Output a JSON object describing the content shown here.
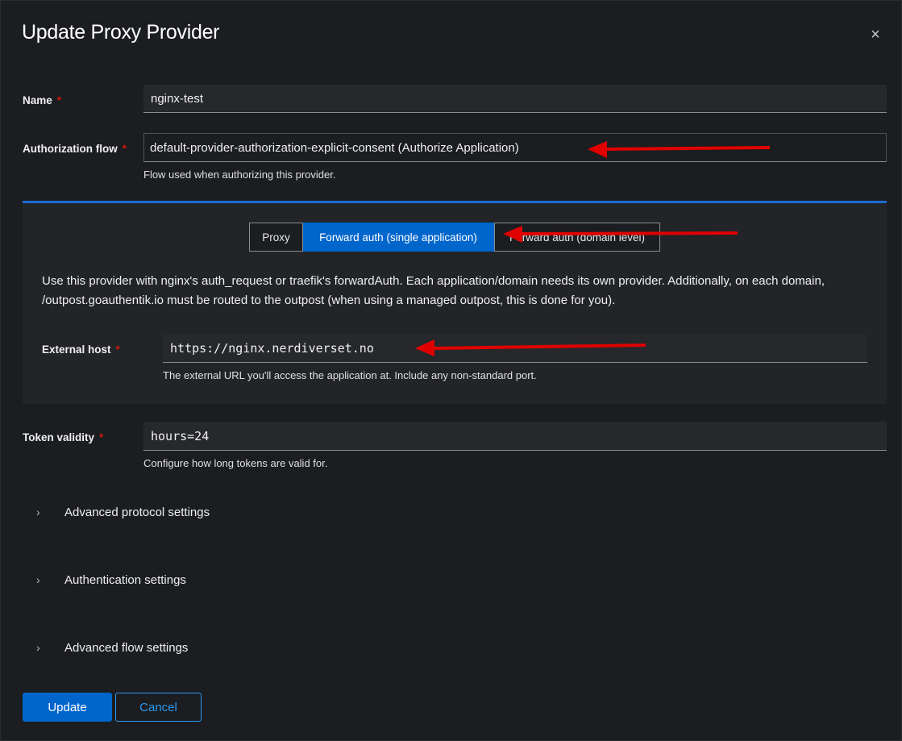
{
  "modal": {
    "title": "Update Proxy Provider",
    "close_glyph": "×"
  },
  "name": {
    "label": "Name",
    "required": "*",
    "value": "nginx-test"
  },
  "authorization_flow": {
    "label": "Authorization flow",
    "required": "*",
    "value": "default-provider-authorization-explicit-consent (Authorize Application)",
    "helper": "Flow used when authorizing this provider."
  },
  "mode": {
    "options": [
      {
        "label": "Proxy",
        "active": false
      },
      {
        "label": "Forward auth (single application)",
        "active": true
      },
      {
        "label": "Forward auth (domain level)",
        "active": false
      }
    ],
    "description": "Use this provider with nginx's auth_request or traefik's forwardAuth. Each application/domain needs its own provider. Additionally, on each domain, /outpost.goauthentik.io must be routed to the outpost (when using a managed outpost, this is done for you)."
  },
  "external_host": {
    "label": "External host",
    "required": "*",
    "value": "https://nginx.nerdiverset.no",
    "helper": "The external URL you'll access the application at. Include any non-standard port."
  },
  "token_validity": {
    "label": "Token validity",
    "required": "*",
    "value": "hours=24",
    "helper": "Configure how long tokens are valid for."
  },
  "sections": [
    {
      "label": "Advanced protocol settings"
    },
    {
      "label": "Authentication settings"
    },
    {
      "label": "Advanced flow settings"
    }
  ],
  "actions": {
    "update": "Update",
    "cancel": "Cancel"
  },
  "colors": {
    "accent": "#0066cc",
    "required": "#c9190b",
    "annotation_arrow": "#e00000",
    "background": "#1b1d21"
  },
  "icons": {
    "close": "close-icon",
    "chevron": "chevron-right-icon"
  }
}
